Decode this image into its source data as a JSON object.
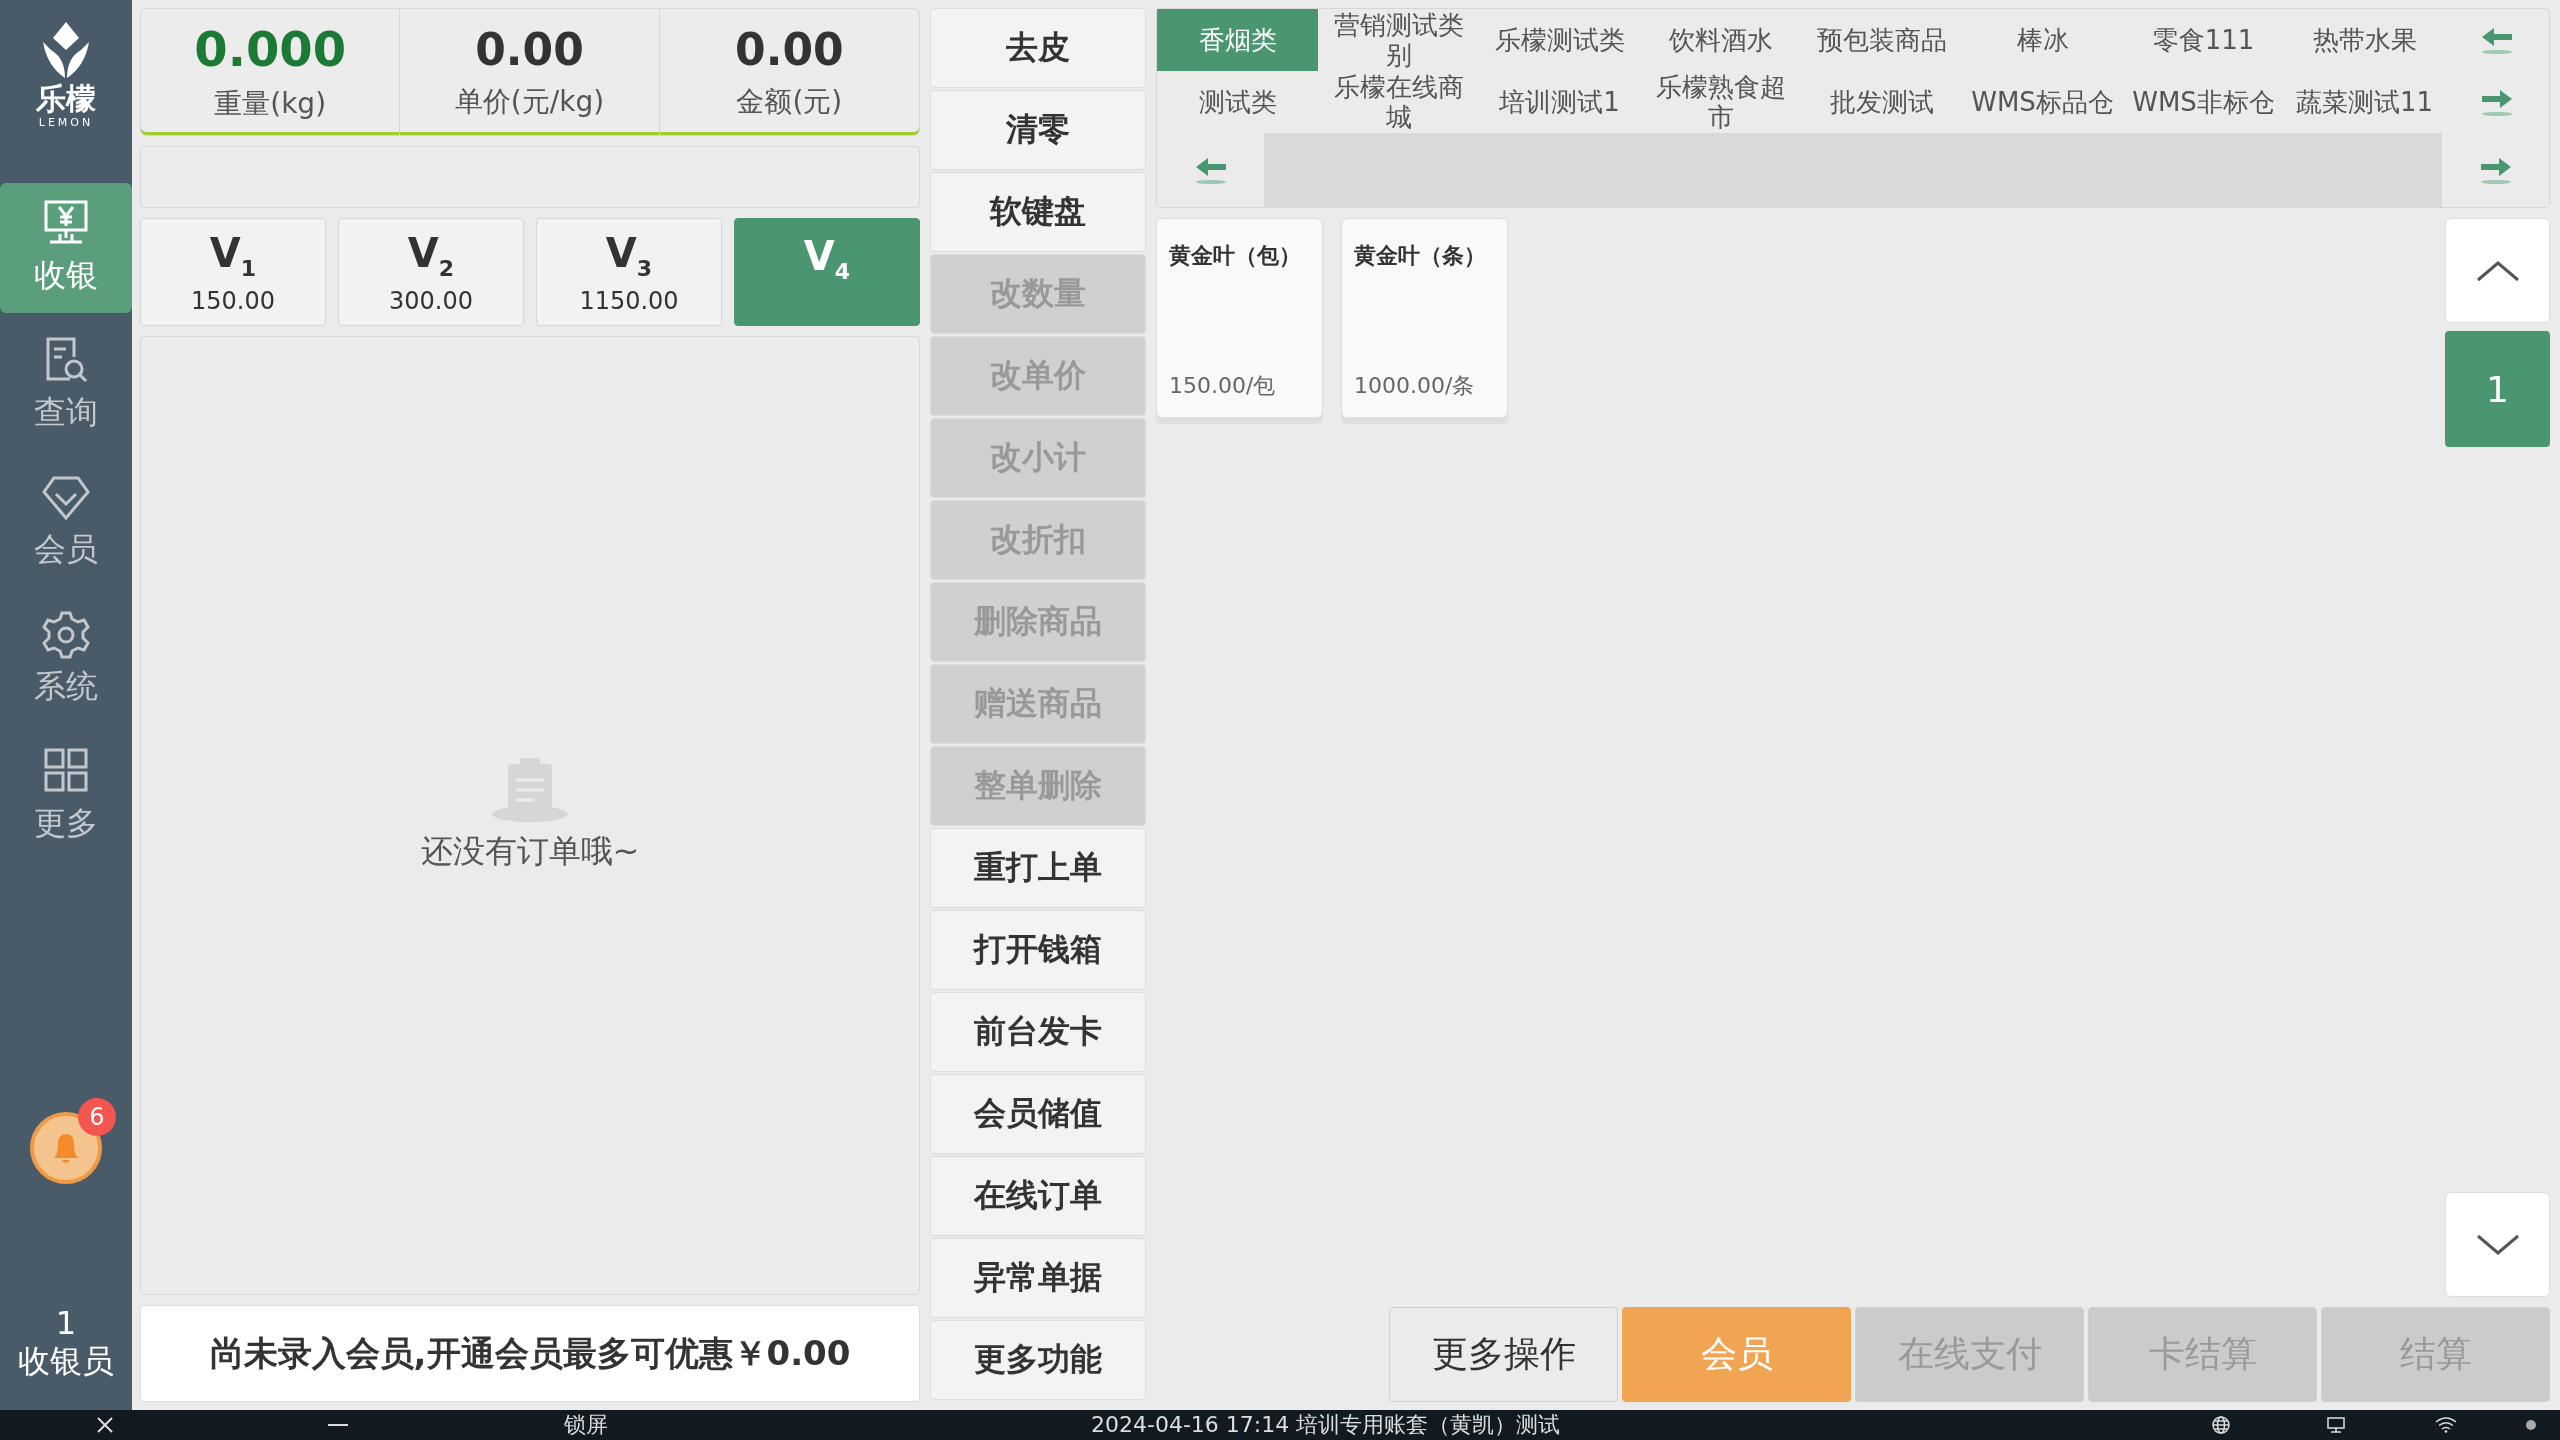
{
  "sidebar": {
    "logo": {
      "name": "乐檬",
      "tagline": "LEMON"
    },
    "items": [
      {
        "label": "收银",
        "kind": "register",
        "selected": true
      },
      {
        "label": "查询",
        "kind": "search",
        "selected": false
      },
      {
        "label": "会员",
        "kind": "member",
        "selected": false
      },
      {
        "label": "系统",
        "kind": "settings",
        "selected": false
      },
      {
        "label": "更多",
        "kind": "more",
        "selected": false
      }
    ],
    "notifications": {
      "badge": "6"
    },
    "cashier": {
      "number": "1",
      "role": "收银员"
    }
  },
  "scale": [
    {
      "kind": "weight",
      "value": "0.000",
      "label": "重量(kg)"
    },
    {
      "kind": "price",
      "value": "0.00",
      "label": "单价(元/kg)"
    },
    {
      "kind": "amount",
      "value": "0.00",
      "label": "金额(元)"
    }
  ],
  "price_levels": [
    {
      "label": "V$_{1}$",
      "price": "150.00",
      "selected": false
    },
    {
      "label": "V$_{2}$",
      "price": "300.00",
      "selected": false
    },
    {
      "label": "V$_{3}$",
      "price": "1150.00",
      "selected": false
    },
    {
      "label": "V$_{4}$",
      "selected": true
    }
  ],
  "order_list": {
    "empty_message": "还没有订单哦~"
  },
  "member_hint": "尚未录入会员,开通会员最多可优惠￥0.00",
  "functions": [
    {
      "label": "去皮",
      "disabled": false
    },
    {
      "label": "清零",
      "disabled": false
    },
    {
      "label": "软键盘",
      "disabled": false
    },
    {
      "label": "改数量",
      "disabled": true
    },
    {
      "label": "改单价",
      "disabled": true
    },
    {
      "label": "改小计",
      "disabled": true
    },
    {
      "label": "改折扣",
      "disabled": true
    },
    {
      "label": "删除商品",
      "disabled": true
    },
    {
      "label": "赠送商品",
      "disabled": true
    },
    {
      "label": "整单删除",
      "disabled": true
    },
    {
      "label": "重打上单",
      "disabled": false
    },
    {
      "label": "打开钱箱",
      "disabled": false
    },
    {
      "label": "前台发卡",
      "disabled": false
    },
    {
      "label": "会员储值",
      "disabled": false
    },
    {
      "label": "在线订单",
      "disabled": false
    },
    {
      "label": "异常单据",
      "disabled": false
    },
    {
      "label": "更多功能",
      "disabled": false
    }
  ],
  "categories": [
    [
      {
        "label": "香烟类",
        "selected": true
      },
      {
        "label": "营销测试类别",
        "selected": false
      },
      {
        "label": "乐檬测试类",
        "selected": false
      },
      {
        "label": "饮料酒水",
        "selected": false
      },
      {
        "label": "预包装商品",
        "selected": false
      },
      {
        "label": "棒冰",
        "selected": false
      },
      {
        "label": "零食111",
        "selected": false
      },
      {
        "label": "热带水果",
        "selected": false
      }
    ],
    [
      {
        "label": "测试类",
        "selected": false
      },
      {
        "label": "乐檬在线商城",
        "selected": false
      },
      {
        "label": "培训测试1",
        "selected": false
      },
      {
        "label": "乐檬熟食超市",
        "selected": false
      },
      {
        "label": "批发测试",
        "selected": false
      },
      {
        "label": "WMS标品仓",
        "selected": false
      },
      {
        "label": "WMS非标仓",
        "selected": false
      },
      {
        "label": "蔬菜测试11",
        "selected": false
      }
    ]
  ],
  "products": [
    {
      "name": "黄金叶（包）",
      "price": "150.00/包"
    },
    {
      "name": "黄金叶（条）",
      "price": "1000.00/条"
    }
  ],
  "pager": {
    "page": "1"
  },
  "actions": [
    {
      "label": "更多操作",
      "kind": "plain"
    },
    {
      "label": "会员",
      "kind": "primary"
    },
    {
      "label": "在线支付",
      "kind": "disabled"
    },
    {
      "label": "卡结算",
      "kind": "disabled"
    },
    {
      "label": "结算",
      "kind": "disabled"
    }
  ],
  "taskbar": {
    "lock": "锁屏",
    "status": "2024-04-16 17:14 培训专用账套（黄凯）测试"
  }
}
